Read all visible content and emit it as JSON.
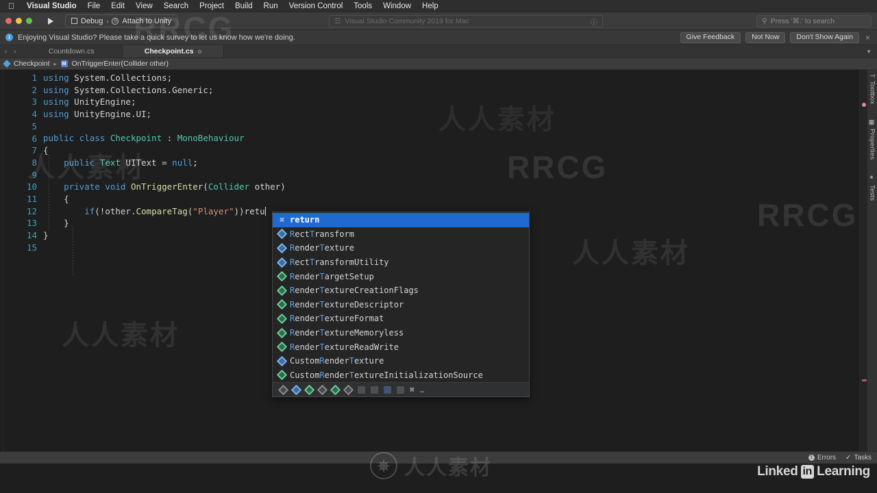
{
  "macmenu": {
    "apple": "apple-logo",
    "items": [
      "Visual Studio",
      "File",
      "Edit",
      "View",
      "Search",
      "Project",
      "Build",
      "Run",
      "Version Control",
      "Tools",
      "Window",
      "Help"
    ]
  },
  "toolbar": {
    "run_label": "run-button",
    "config": "Debug",
    "target": "Attach to Unity",
    "status_text": "Visual Studio Community 2019 for Mac",
    "search_placeholder": "Press '⌘.' to search"
  },
  "notification": {
    "message": "Enjoying Visual Studio? Please take a quick survey to let us know how we're doing.",
    "buttons": [
      "Give Feedback",
      "Not Now",
      "Don't Show Again"
    ],
    "close": "×"
  },
  "tabs": [
    {
      "label": "Countdown.cs",
      "active": false
    },
    {
      "label": "Checkpoint.cs",
      "active": true
    }
  ],
  "breadcrumb": {
    "class": "Checkpoint",
    "member": "OnTriggerEnter(Collider other)"
  },
  "editor": {
    "line_numbers": [
      "1",
      "2",
      "3",
      "4",
      "5",
      "6",
      "7",
      "8",
      "9",
      "10",
      "11",
      "12",
      "13",
      "14",
      "15"
    ],
    "lines": [
      {
        "n": 1,
        "tokens": [
          {
            "t": "using",
            "c": "k"
          },
          {
            "t": " System.Collections;",
            "c": "ns"
          }
        ]
      },
      {
        "n": 2,
        "tokens": [
          {
            "t": "using",
            "c": "k"
          },
          {
            "t": " System.Collections.Generic;",
            "c": "ns"
          }
        ]
      },
      {
        "n": 3,
        "tokens": [
          {
            "t": "using",
            "c": "k"
          },
          {
            "t": " UnityEngine;",
            "c": "ns"
          }
        ]
      },
      {
        "n": 4,
        "tokens": [
          {
            "t": "using",
            "c": "k"
          },
          {
            "t": " UnityEngine.UI;",
            "c": "ns"
          }
        ]
      },
      {
        "n": 5,
        "tokens": []
      },
      {
        "n": 6,
        "tokens": [
          {
            "t": "public class ",
            "c": "k"
          },
          {
            "t": "Checkpoint",
            "c": "ty"
          },
          {
            "t": " : ",
            "c": "pl"
          },
          {
            "t": "MonoBehaviour",
            "c": "ty"
          }
        ]
      },
      {
        "n": 7,
        "tokens": [
          {
            "t": "{",
            "c": "pl"
          }
        ]
      },
      {
        "n": 8,
        "tokens": [
          {
            "t": "    public ",
            "c": "k"
          },
          {
            "t": "Text",
            "c": "ty"
          },
          {
            "t": " UIText = ",
            "c": "pl"
          },
          {
            "t": "null",
            "c": "k"
          },
          {
            "t": ";",
            "c": "pl"
          }
        ]
      },
      {
        "n": 9,
        "tokens": []
      },
      {
        "n": 10,
        "tokens": [
          {
            "t": "    private void ",
            "c": "k"
          },
          {
            "t": "OnTriggerEnter",
            "c": "fn"
          },
          {
            "t": "(",
            "c": "pl"
          },
          {
            "t": "Collider",
            "c": "ty"
          },
          {
            "t": " other)",
            "c": "pl"
          }
        ]
      },
      {
        "n": 11,
        "tokens": [
          {
            "t": "    {",
            "c": "pl"
          }
        ]
      },
      {
        "n": 12,
        "tokens": [
          {
            "t": "        ",
            "c": "pl"
          },
          {
            "t": "if",
            "c": "k"
          },
          {
            "t": "(!other.",
            "c": "pl"
          },
          {
            "t": "CompareTag",
            "c": "fn"
          },
          {
            "t": "(",
            "c": "pl"
          },
          {
            "t": "\"Player\"",
            "c": "st"
          },
          {
            "t": "))retu",
            "c": "pl"
          }
        ],
        "cursor": true
      },
      {
        "n": 13,
        "tokens": [
          {
            "t": "    }",
            "c": "pl"
          }
        ]
      },
      {
        "n": 14,
        "tokens": [
          {
            "t": "}",
            "c": "pl"
          }
        ]
      },
      {
        "n": 15,
        "tokens": []
      }
    ]
  },
  "autocomplete": {
    "items": [
      {
        "icon": "command-glyph",
        "kind": "keyword",
        "pre": "",
        "match": "",
        "post": "return",
        "selected": true
      },
      {
        "icon": "class-icon",
        "kind": "class",
        "segments": [
          {
            "t": "R",
            "m": true
          },
          {
            "t": "ect",
            "m": false
          },
          {
            "t": "T",
            "m": true
          },
          {
            "t": "ransform",
            "m": false
          }
        ]
      },
      {
        "icon": "class-icon",
        "kind": "class",
        "segments": [
          {
            "t": "R",
            "m": true
          },
          {
            "t": "ender",
            "m": false
          },
          {
            "t": "T",
            "m": true
          },
          {
            "t": "exture",
            "m": false
          }
        ]
      },
      {
        "icon": "class-icon",
        "kind": "class",
        "segments": [
          {
            "t": "R",
            "m": true
          },
          {
            "t": "ect",
            "m": false
          },
          {
            "t": "T",
            "m": true
          },
          {
            "t": "ransformUtility",
            "m": false
          }
        ]
      },
      {
        "icon": "struct-icon",
        "kind": "struct",
        "segments": [
          {
            "t": "R",
            "m": true
          },
          {
            "t": "ender",
            "m": false
          },
          {
            "t": "T",
            "m": true
          },
          {
            "t": "argetSetup",
            "m": false
          }
        ]
      },
      {
        "icon": "enum-icon",
        "kind": "enum",
        "segments": [
          {
            "t": "R",
            "m": true
          },
          {
            "t": "ender",
            "m": false
          },
          {
            "t": "T",
            "m": true
          },
          {
            "t": "extureCreationFlags",
            "m": false
          }
        ]
      },
      {
        "icon": "struct-icon",
        "kind": "struct",
        "segments": [
          {
            "t": "R",
            "m": true
          },
          {
            "t": "ender",
            "m": false
          },
          {
            "t": "T",
            "m": true
          },
          {
            "t": "extureDescriptor",
            "m": false
          }
        ]
      },
      {
        "icon": "enum-icon",
        "kind": "enum",
        "segments": [
          {
            "t": "R",
            "m": true
          },
          {
            "t": "ender",
            "m": false
          },
          {
            "t": "T",
            "m": true
          },
          {
            "t": "extureFormat",
            "m": false
          }
        ]
      },
      {
        "icon": "struct-icon",
        "kind": "struct",
        "segments": [
          {
            "t": "R",
            "m": true
          },
          {
            "t": "ender",
            "m": false
          },
          {
            "t": "T",
            "m": true
          },
          {
            "t": "extureMemoryless",
            "m": false
          }
        ]
      },
      {
        "icon": "enum-icon",
        "kind": "enum",
        "segments": [
          {
            "t": "R",
            "m": true
          },
          {
            "t": "ender",
            "m": false
          },
          {
            "t": "T",
            "m": true
          },
          {
            "t": "extureReadWrite",
            "m": false
          }
        ]
      },
      {
        "icon": "class-icon",
        "kind": "class",
        "segments": [
          {
            "t": "Custom",
            "m": false
          },
          {
            "t": "R",
            "m": true
          },
          {
            "t": "ender",
            "m": false
          },
          {
            "t": "T",
            "m": true
          },
          {
            "t": "exture",
            "m": false
          }
        ]
      },
      {
        "icon": "enum-icon",
        "kind": "enum",
        "segments": [
          {
            "t": "Custom",
            "m": false
          },
          {
            "t": "R",
            "m": true
          },
          {
            "t": "ender",
            "m": false
          },
          {
            "t": "T",
            "m": true
          },
          {
            "t": "extureInitializationSource",
            "m": false
          }
        ]
      }
    ],
    "footer_icons": [
      "filter-all-icon",
      "filter-class-icon",
      "filter-struct-icon",
      "filter-interface-icon",
      "filter-enum-icon",
      "filter-delegate-icon",
      "filter-field-icon",
      "filter-property-icon",
      "filter-method-icon",
      "filter-event-icon"
    ],
    "footer_command": "⌘",
    "footer_more": "…"
  },
  "sidepads": [
    {
      "label": "Toolbox",
      "glyph": "T"
    },
    {
      "label": "Properties",
      "glyph": "▣"
    },
    {
      "label": "Tests",
      "glyph": "✦"
    }
  ],
  "statusbar": {
    "errors": "Errors",
    "tasks": "Tasks"
  },
  "watermarks": {
    "brand": "RRCG",
    "cn": "人人素材",
    "linkedin_left": "Linked",
    "linkedin_in": "in",
    "linkedin_right": "Learning"
  }
}
